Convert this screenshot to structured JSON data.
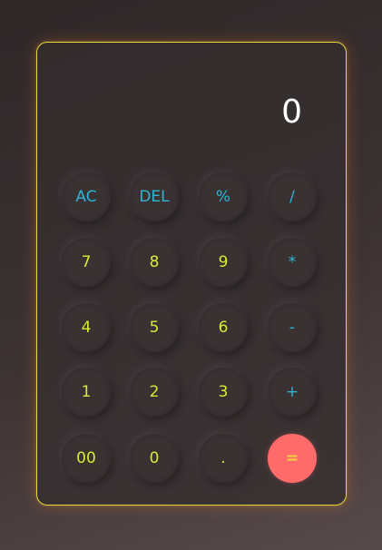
{
  "display": {
    "value": "0"
  },
  "buttons": {
    "ac": "AC",
    "del": "DEL",
    "percent": "%",
    "divide": "/",
    "seven": "7",
    "eight": "8",
    "nine": "9",
    "multiply": "*",
    "four": "4",
    "five": "5",
    "six": "6",
    "subtract": "-",
    "one": "1",
    "two": "2",
    "three": "3",
    "add": "+",
    "double_zero": "00",
    "zero": "0",
    "decimal": ".",
    "equals": "="
  },
  "colors": {
    "border": "#e9d63c",
    "function_text": "#2fb4d6",
    "number_text": "#d7ec35",
    "equals_bg": "#ff6b6b",
    "display_text": "#ffffff"
  }
}
